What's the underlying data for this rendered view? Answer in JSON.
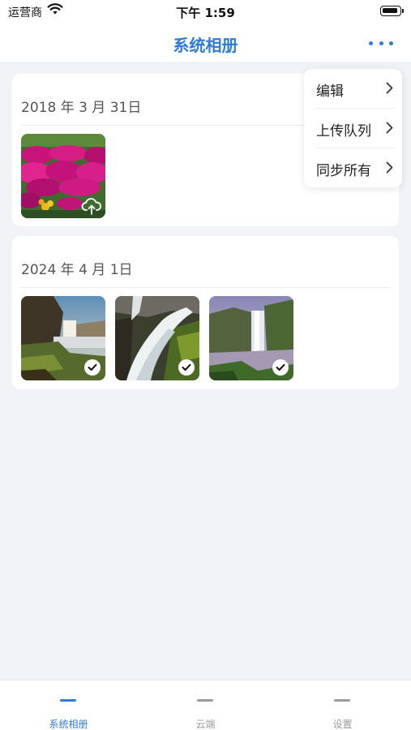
{
  "status_bar": {
    "carrier": "运营商",
    "time": "下午 1:59"
  },
  "nav": {
    "title": "系统相册"
  },
  "albums": [
    {
      "date": "2018 年 3 月 31日",
      "photos": [
        {
          "icon": "cloud-upload-icon",
          "status": "not-uploaded"
        }
      ]
    },
    {
      "date": "2024 年 4 月 1日",
      "photos": [
        {
          "icon": "check-icon",
          "status": "uploaded"
        },
        {
          "icon": "check-icon",
          "status": "uploaded"
        },
        {
          "icon": "check-icon",
          "status": "uploaded"
        }
      ]
    }
  ],
  "menu": {
    "items": [
      {
        "label": "编辑",
        "icon": "chevron-right-icon"
      },
      {
        "label": "上传队列",
        "icon": "chevron-right-icon"
      },
      {
        "label": "同步所有",
        "icon": "chevron-right-icon"
      }
    ]
  },
  "tabs": [
    {
      "label": "系统相册",
      "active": true
    },
    {
      "label": "云端",
      "active": false
    },
    {
      "label": "设置",
      "active": false
    }
  ],
  "colors": {
    "accent": "#2f7bd8",
    "inactive": "#9a9a9f",
    "background": "#f2f3f7"
  }
}
